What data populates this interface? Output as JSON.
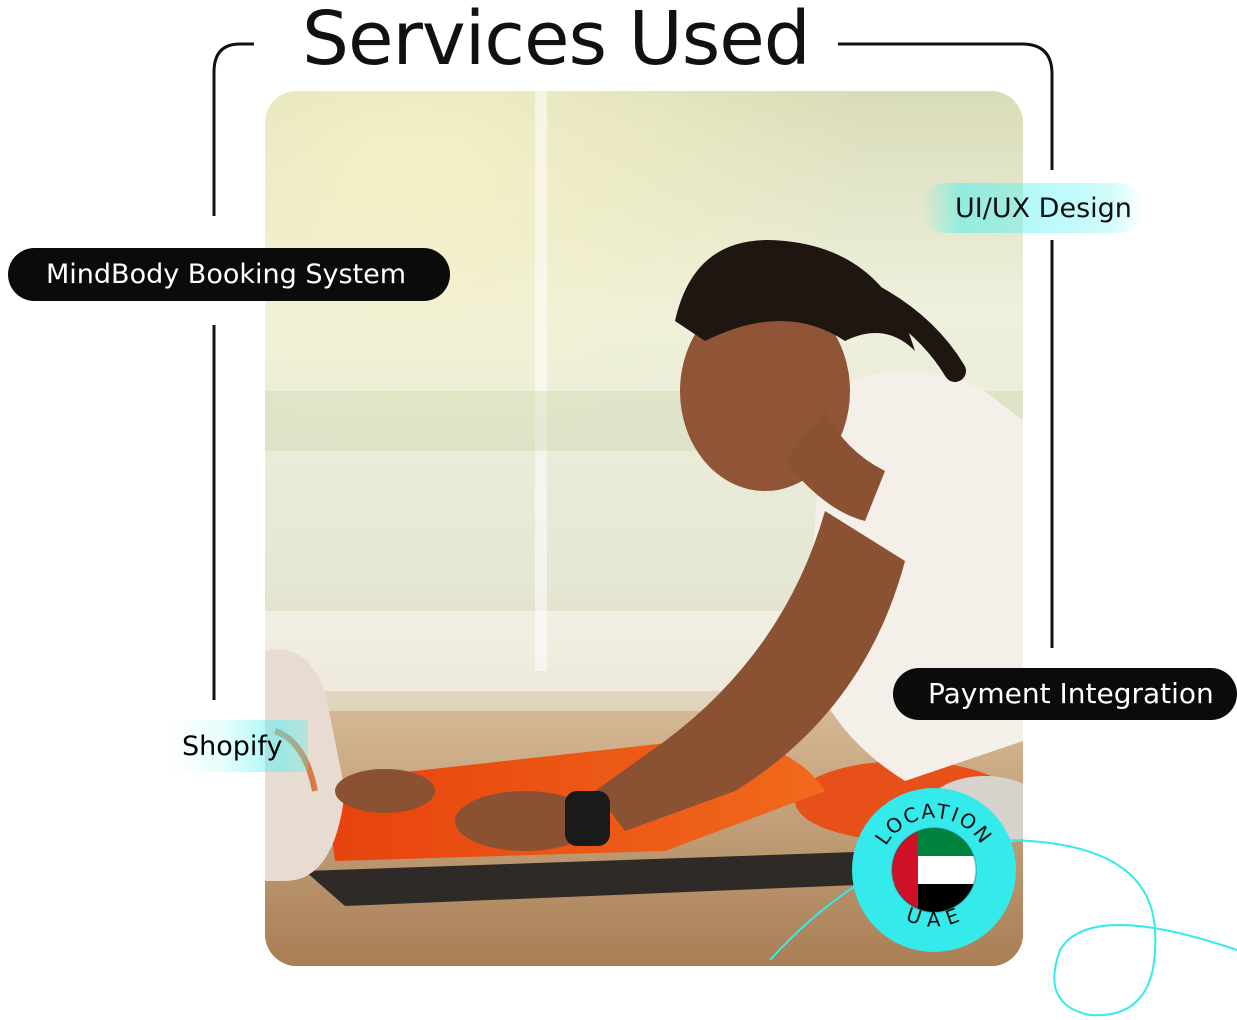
{
  "title": "Services Used",
  "services": {
    "mindbody": "MindBody Booking System",
    "uiux": "UI/UX Design",
    "payment": "Payment Integration",
    "shopify": "Shopify"
  },
  "location_badge": {
    "top_text": "LOCATION",
    "bottom_text": "UAE",
    "flag_icon": "uae-flag-icon"
  },
  "colors": {
    "accent_cyan": "#34eaea",
    "pill_dark": "#0b0b0b",
    "flag_green": "#00843d",
    "flag_red": "#ce1126",
    "flag_black": "#000000"
  }
}
